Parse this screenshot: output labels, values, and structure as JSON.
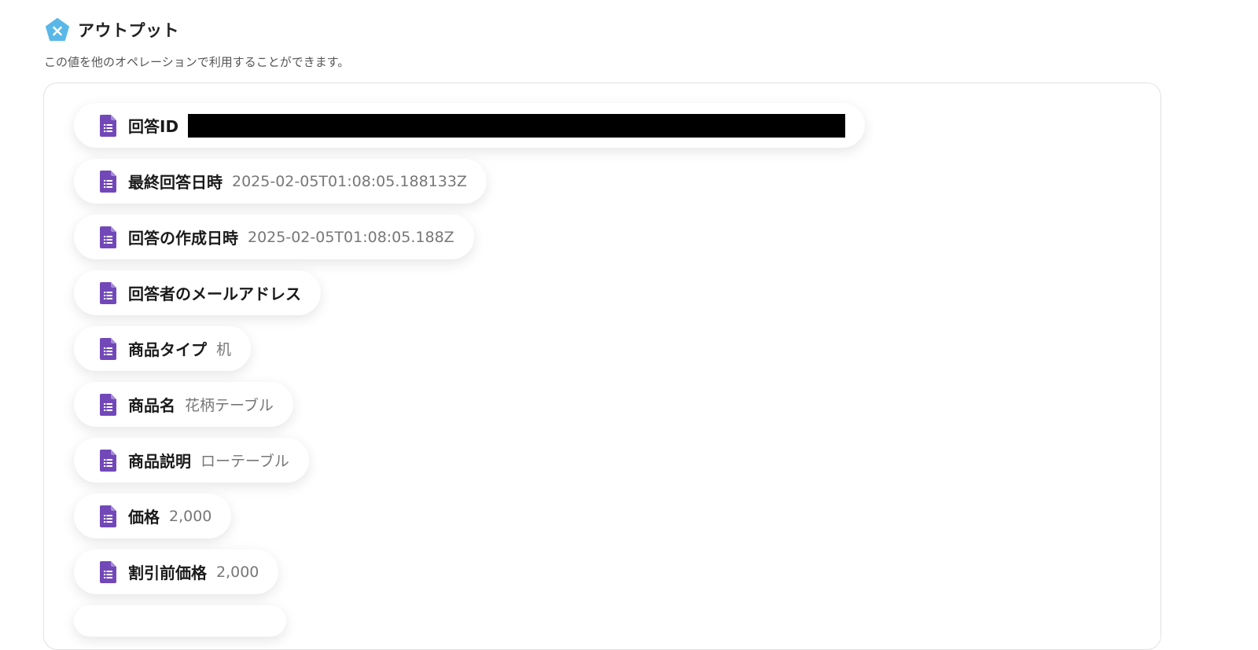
{
  "header": {
    "title": "アウトプット",
    "subtitle": "この値を他のオペレーションで利用することができます。",
    "logo_icon": "yoom-pentagon-x-icon"
  },
  "colors": {
    "accent": "#5ab8e8",
    "icon_purple": "#7248b9",
    "panel_border": "#e2e2e2"
  },
  "outputs": [
    {
      "label": "回答ID",
      "value": "",
      "redacted": true,
      "icon": "google-forms-icon"
    },
    {
      "label": "最終回答日時",
      "value": "2025-02-05T01:08:05.188133Z",
      "icon": "google-forms-icon"
    },
    {
      "label": "回答の作成日時",
      "value": "2025-02-05T01:08:05.188Z",
      "icon": "google-forms-icon"
    },
    {
      "label": "回答者のメールアドレス",
      "value": "",
      "icon": "google-forms-icon"
    },
    {
      "label": "商品タイプ",
      "value": "机",
      "icon": "google-forms-icon"
    },
    {
      "label": "商品名",
      "value": "花柄テーブル",
      "icon": "google-forms-icon"
    },
    {
      "label": "商品説明",
      "value": "ローテーブル",
      "icon": "google-forms-icon"
    },
    {
      "label": "価格",
      "value": "2,000",
      "icon": "google-forms-icon"
    },
    {
      "label": "割引前価格",
      "value": "2,000",
      "icon": "google-forms-icon"
    }
  ]
}
